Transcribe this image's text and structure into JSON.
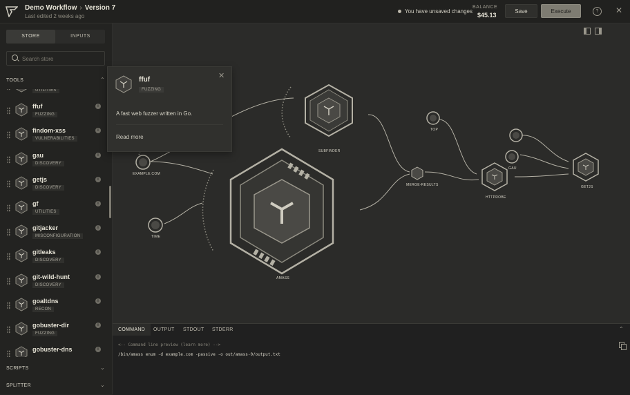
{
  "header": {
    "workflow_name": "Demo Workflow",
    "version": "Version 7",
    "last_edited": "Last edited 2 weeks ago",
    "unsaved_text": "You have unsaved changes",
    "balance_label": "BALANCE",
    "balance_value": "$45.13",
    "save_label": "Save",
    "execute_label": "Execute",
    "help_glyph": "?",
    "close_glyph": "✕"
  },
  "sidebar": {
    "tabs": [
      {
        "label": "STORE",
        "active": true
      },
      {
        "label": "INPUTS",
        "active": false
      }
    ],
    "search_placeholder": "Search store",
    "sections": {
      "tools": "TOOLS",
      "scripts": "SCRIPTS",
      "splitter": "SPLITTER"
    },
    "tools": [
      {
        "name": "",
        "category": "UTILITIES"
      },
      {
        "name": "ffuf",
        "category": "FUZZING"
      },
      {
        "name": "findom-xss",
        "category": "VULNERABILITIES"
      },
      {
        "name": "gau",
        "category": "DISCOVERY"
      },
      {
        "name": "getjs",
        "category": "DISCOVERY"
      },
      {
        "name": "gf",
        "category": "UTILITIES"
      },
      {
        "name": "gitjacker",
        "category": "MISCONFIGURATION"
      },
      {
        "name": "gitleaks",
        "category": "DISCOVERY"
      },
      {
        "name": "git-wild-hunt",
        "category": "DISCOVERY"
      },
      {
        "name": "goaltdns",
        "category": "RECON"
      },
      {
        "name": "gobuster-dir",
        "category": "FUZZING"
      },
      {
        "name": "gobuster-dns",
        "category": ""
      }
    ]
  },
  "popover": {
    "name": "ffuf",
    "category": "FUZZING",
    "description": "A fast web fuzzer written in Go.",
    "read_more": "Read more",
    "close_glyph": "✕"
  },
  "canvas": {
    "nodes": {
      "subfinder": "SUBFINDER",
      "example": "EXAMPLE.COM",
      "time": "TIME",
      "amass": "AMASS",
      "merge": "MERGE-RESULTS",
      "top": "TOP",
      "httprobe": "HTTPROBE",
      "small_a": "",
      "small_b": "GAU",
      "getjs": "GETJS"
    }
  },
  "bottom": {
    "tabs": [
      {
        "label": "COMMAND",
        "active": true
      },
      {
        "label": "OUTPUT",
        "active": false
      },
      {
        "label": "STDOUT",
        "active": false
      },
      {
        "label": "STDERR",
        "active": false
      }
    ],
    "preview_comment": "<-- Command line preview (learn more) -->",
    "command": "/bin/amass enum -d example.com -passive -o out/amass-0/output.txt"
  },
  "colors": {
    "background": "#262624",
    "panel": "#232321",
    "canvas": "#2b2b29",
    "accent_button": "#7e7c72",
    "text": "#cfccc0"
  },
  "icons": [
    "logo-icon",
    "chevron-right-icon",
    "dot-icon",
    "help-icon",
    "close-icon",
    "search-icon",
    "chevron-up-icon",
    "chevron-down-icon",
    "grip-icon",
    "hex-tool-icon",
    "info-icon",
    "panel-left-icon",
    "panel-right-icon",
    "copy-icon"
  ]
}
